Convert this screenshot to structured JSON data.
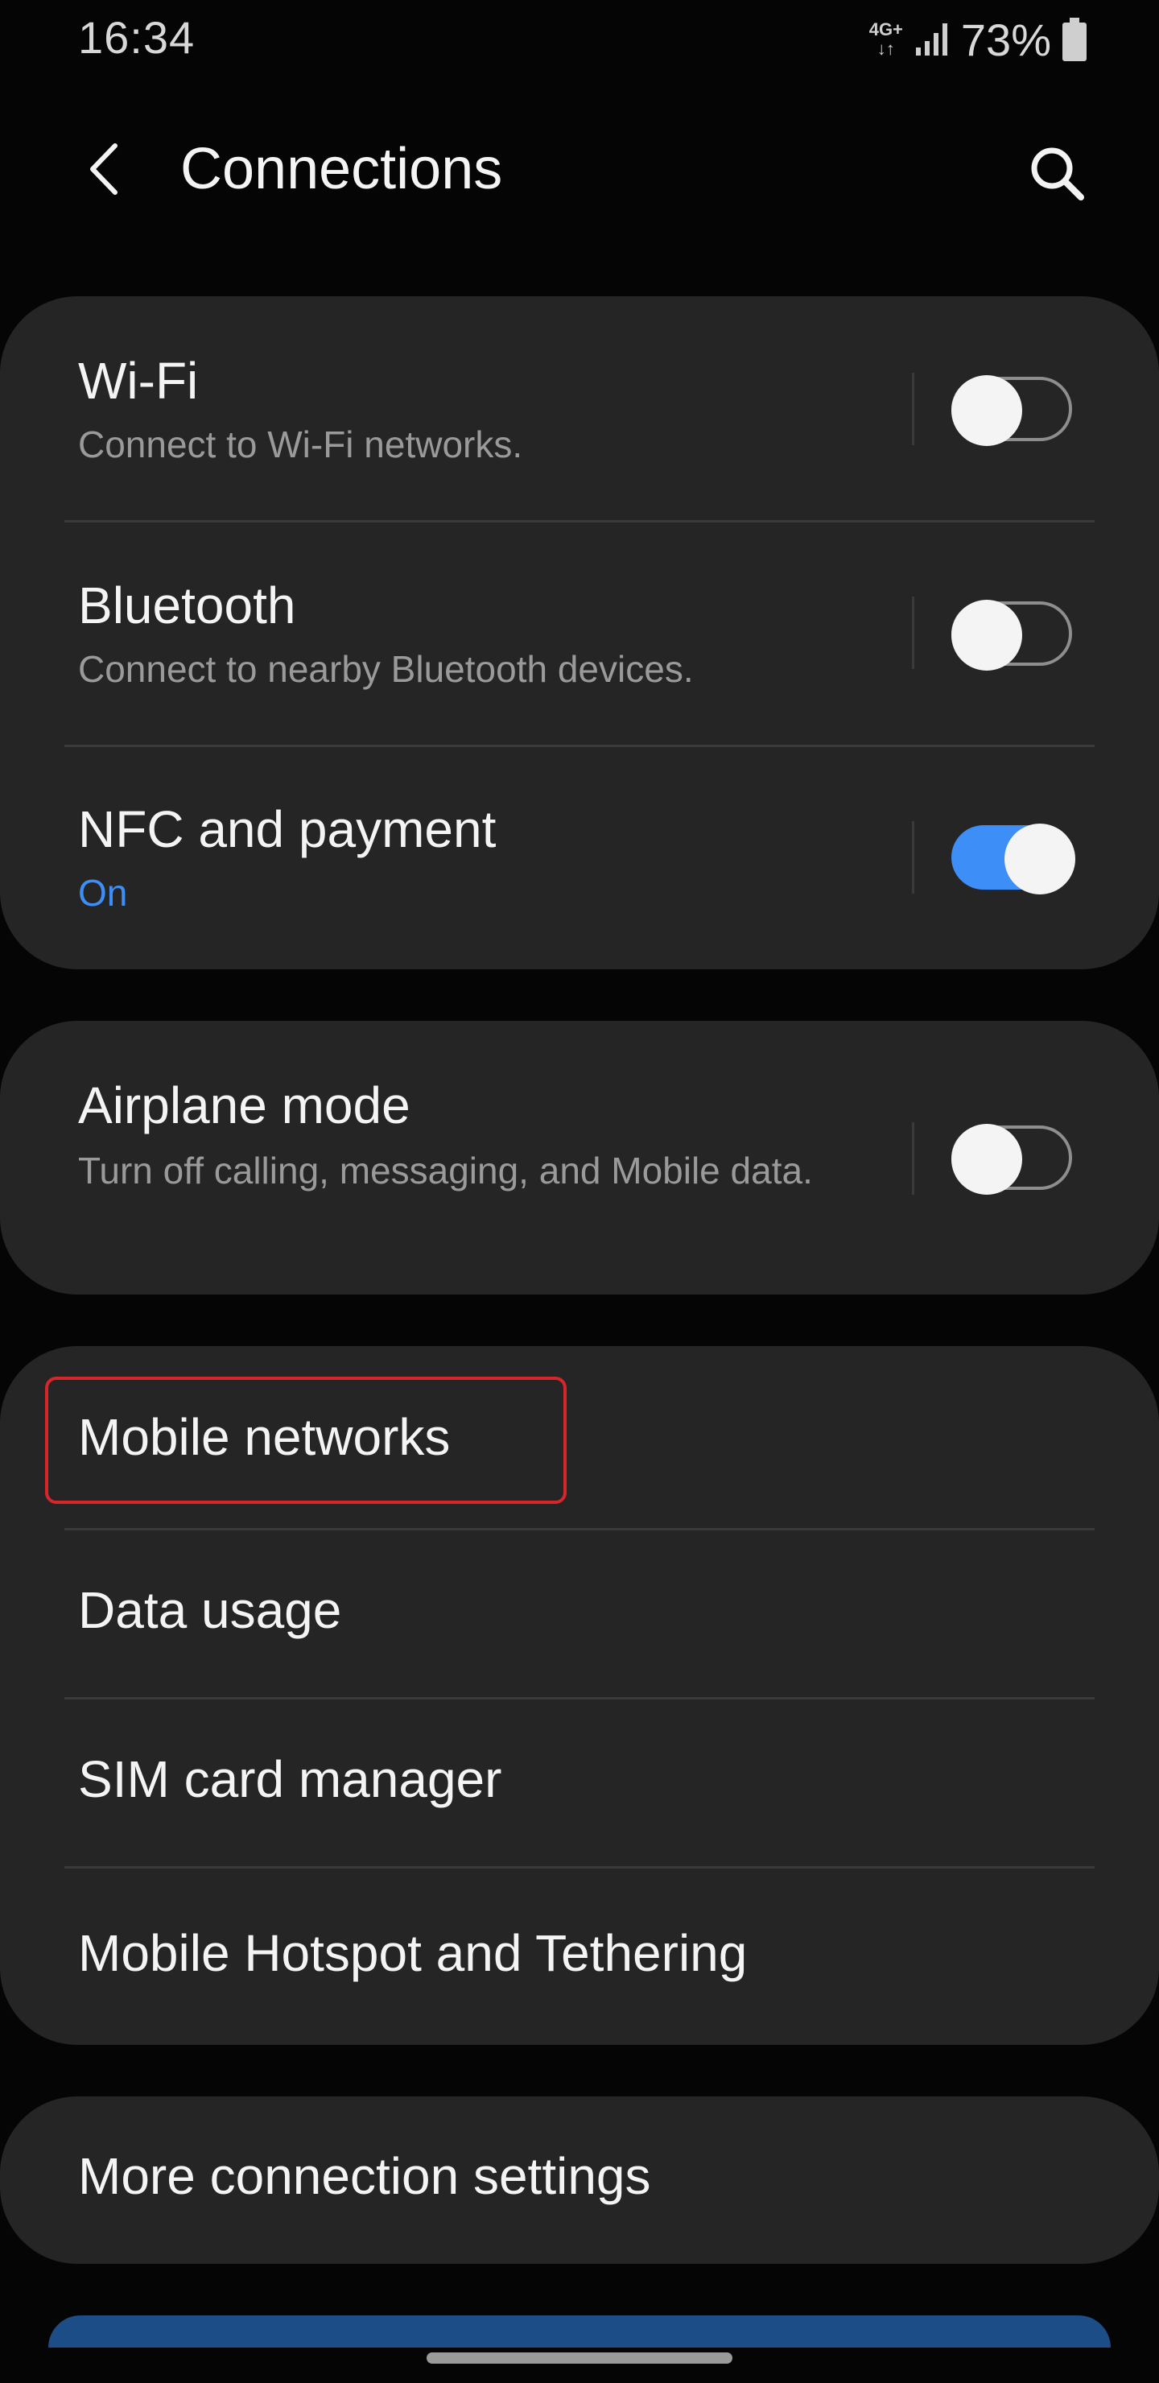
{
  "status_bar": {
    "time": "16:34",
    "network": "4G+",
    "network_arrows": "↓↑",
    "battery_percent": "73%"
  },
  "app_bar": {
    "title": "Connections"
  },
  "groups": [
    {
      "rows": [
        {
          "title": "Wi-Fi",
          "subtitle": "Connect to Wi-Fi networks.",
          "toggle": false
        },
        {
          "title": "Bluetooth",
          "subtitle": "Connect to nearby Bluetooth devices.",
          "toggle": false
        },
        {
          "title": "NFC and payment",
          "subtitle": "On",
          "toggle": true
        }
      ]
    },
    {
      "rows": [
        {
          "title": "Airplane mode",
          "subtitle": "Turn off calling, messaging, and Mobile data.",
          "toggle": false
        }
      ]
    },
    {
      "rows": [
        {
          "title": "Mobile networks"
        },
        {
          "title": "Data usage"
        },
        {
          "title": "SIM card manager"
        },
        {
          "title": "Mobile Hotspot and Tethering"
        }
      ]
    },
    {
      "rows": [
        {
          "title": "More connection settings"
        }
      ]
    }
  ],
  "colors": {
    "background": "#050505",
    "card": "#252525",
    "accent": "#3e8ef7",
    "highlight": "#d6262b"
  }
}
